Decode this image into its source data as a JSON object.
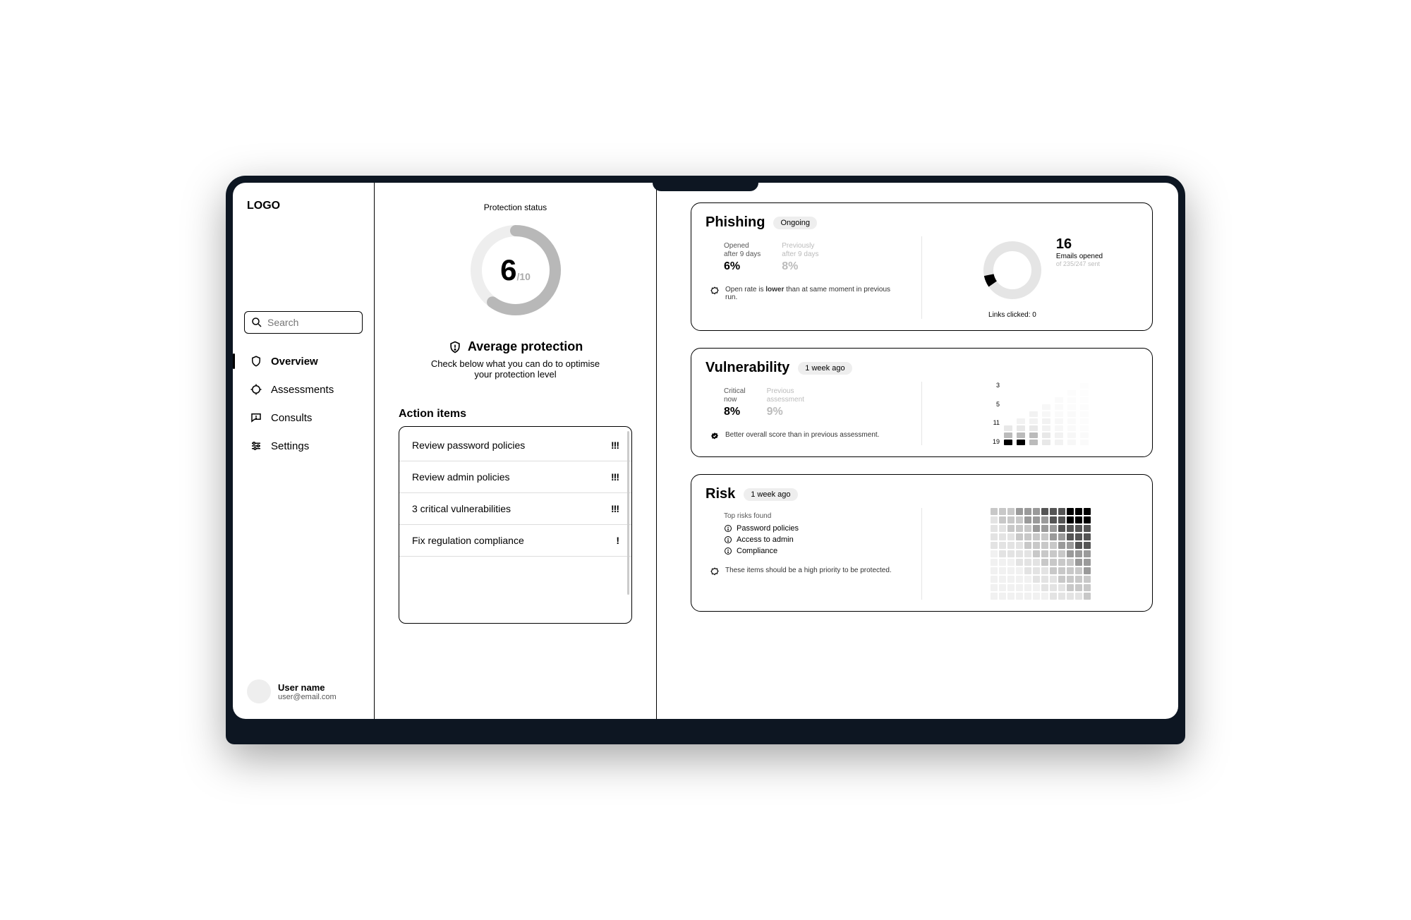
{
  "logo": "LOGO",
  "search": {
    "placeholder": "Search"
  },
  "nav": {
    "overview": "Overview",
    "assessments": "Assessments",
    "consults": "Consults",
    "settings": "Settings"
  },
  "user": {
    "name": "User name",
    "email": "user@email.com"
  },
  "protection": {
    "label": "Protection status",
    "score": "6",
    "out_of": "/10",
    "status_title": "Average protection",
    "status_desc": "Check below what you can do to optimise your protection level"
  },
  "actions": {
    "title": "Action items",
    "items": [
      {
        "label": "Review password policies",
        "sev": "!!!"
      },
      {
        "label": "Review admin policies",
        "sev": "!!!"
      },
      {
        "label": "3 critical vulnerabilities",
        "sev": "!!!"
      },
      {
        "label": "Fix regulation compliance",
        "sev": "!"
      }
    ]
  },
  "phishing": {
    "title": "Phishing",
    "badge": "Ongoing",
    "opened_label": "Opened\nafter 9 days",
    "opened_value": "6%",
    "prev_label": "Previously\nafter 9 days",
    "prev_value": "8%",
    "insight_pre": "Open rate is ",
    "insight_bold": "lower",
    "insight_post": " than at same moment in previous run.",
    "count": "16",
    "count_label": "Emails opened",
    "count_sub": "of 235/247 sent",
    "links": "Links clicked: 0"
  },
  "vulnerability": {
    "title": "Vulnerability",
    "badge": "1 week ago",
    "crit_label": "Critical\nnow",
    "crit_value": "8%",
    "prev_label": "Previous\nassessment",
    "prev_value": "9%",
    "insight": "Better overall score than in previous assessment.",
    "axis": [
      "3",
      "5",
      "11",
      "19"
    ]
  },
  "risk": {
    "title": "Risk",
    "badge": "1 week ago",
    "top_label": "Top risks found",
    "items": [
      "Password policies",
      "Access to admin",
      "Compliance"
    ],
    "insight": "These items should be a high priority to be protected."
  }
}
